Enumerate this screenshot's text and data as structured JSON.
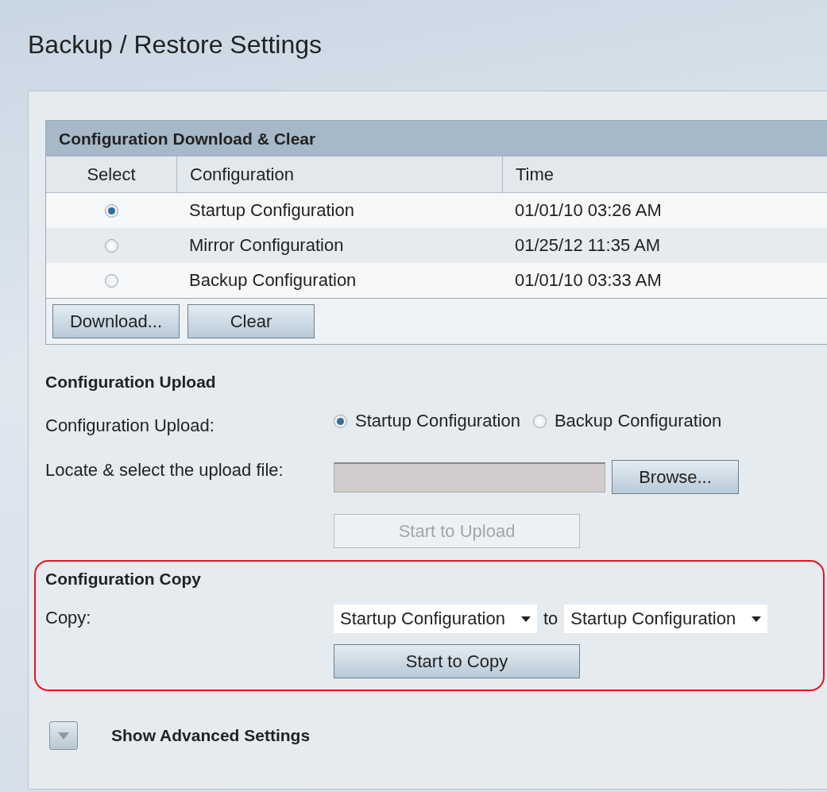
{
  "page": {
    "title": "Backup / Restore Settings"
  },
  "download_clear": {
    "title": "Configuration Download & Clear",
    "columns": [
      "Select",
      "Configuration",
      "Time"
    ],
    "rows": [
      {
        "selected": true,
        "configuration": "Startup Configuration",
        "time": "01/01/10 03:26 AM"
      },
      {
        "selected": false,
        "configuration": "Mirror Configuration",
        "time": "01/25/12 11:35 AM"
      },
      {
        "selected": false,
        "configuration": "Backup Configuration",
        "time": "01/01/10 03:33 AM"
      }
    ],
    "buttons": [
      "Download...",
      "Clear"
    ]
  },
  "upload": {
    "title": "Configuration Upload",
    "label": "Configuration Upload:",
    "options": [
      {
        "label": "Startup Configuration",
        "selected": true
      },
      {
        "label": "Backup Configuration",
        "selected": false
      }
    ],
    "file_label": "Locate & select the upload file:",
    "browse_button": "Browse...",
    "start_button": {
      "label": "Start to Upload",
      "disabled": true
    }
  },
  "copy": {
    "title": "Configuration Copy",
    "highlighted": true,
    "label": "Copy:",
    "from": "Startup Configuration",
    "joiner": "to",
    "to": "Startup Configuration",
    "start_button": {
      "label": "Start to Copy",
      "disabled": false
    }
  },
  "advanced": {
    "label": "Show Advanced Settings",
    "expanded": false
  }
}
